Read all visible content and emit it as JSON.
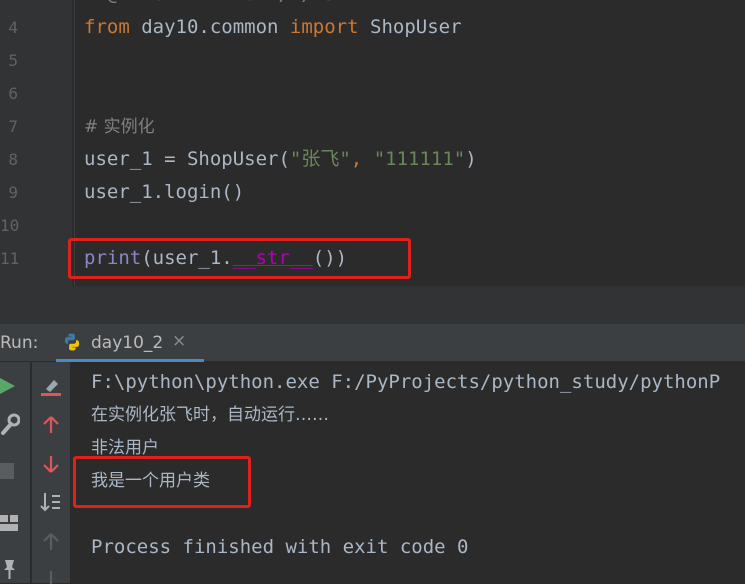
{
  "editor": {
    "lines": [
      {
        "num": "4",
        "tokens": [
          {
            "t": "from ",
            "c": "kw"
          },
          {
            "t": "day10.common ",
            "c": "ident"
          },
          {
            "t": "import ",
            "c": "kw"
          },
          {
            "t": "ShopUser",
            "c": "ident"
          }
        ]
      },
      {
        "num": "5",
        "tokens": []
      },
      {
        "num": "6",
        "tokens": []
      },
      {
        "num": "7",
        "tokens": [
          {
            "t": "# 实例化",
            "c": "cmt"
          }
        ]
      },
      {
        "num": "8",
        "tokens": [
          {
            "t": "user_1 = ShopUser(",
            "c": "ident"
          },
          {
            "t": "\"张飞\"",
            "c": "str"
          },
          {
            "t": ", ",
            "c": "kw"
          },
          {
            "t": "\"111111\"",
            "c": "str"
          },
          {
            "t": ")",
            "c": "ident"
          }
        ]
      },
      {
        "num": "9",
        "tokens": [
          {
            "t": "user_1.login()",
            "c": "ident"
          }
        ]
      },
      {
        "num": "10",
        "tokens": []
      },
      {
        "num": "11",
        "tokens": [
          {
            "t": "print",
            "c": "builtin"
          },
          {
            "t": "(user_1.",
            "c": "ident"
          },
          {
            "t": "__str__",
            "c": "dunder"
          },
          {
            "t": "())",
            "c": "ident"
          }
        ]
      }
    ]
  },
  "run_panel": {
    "label": "Run:",
    "tab": {
      "name": "day10_2",
      "close": "×"
    }
  },
  "console": {
    "lines": [
      {
        "text": "F:\\python\\python.exe F:/PyProjects/python_study/pythonP",
        "style": "mono"
      },
      {
        "text": "在实例化张飞时，自动运行……",
        "style": "cn"
      },
      {
        "text": "非法用户",
        "style": "cn"
      },
      {
        "text": "我是一个用户类",
        "style": "cn"
      },
      {
        "text": "",
        "style": "mono"
      },
      {
        "text": "Process finished with exit code 0",
        "style": "mono"
      }
    ]
  },
  "colors": {
    "background": "#2b2b2b",
    "keyword": "#cc7832",
    "string": "#6a8759",
    "comment": "#808080",
    "builtin": "#8888c6",
    "dunder": "#b200b2",
    "highlight_box": "#e0201a",
    "run_green": "#59a869"
  },
  "icons": {
    "tab": "python-icon",
    "left_tools": [
      "rerun-icon",
      "wrench-icon",
      "stop-icon",
      "layout-icon",
      "pin-icon"
    ],
    "right_tools": [
      "clear-icon",
      "up-arrow-icon",
      "down-arrow-icon",
      "sort-icon",
      "scroll-up-icon",
      "scroll-down-icon"
    ]
  }
}
